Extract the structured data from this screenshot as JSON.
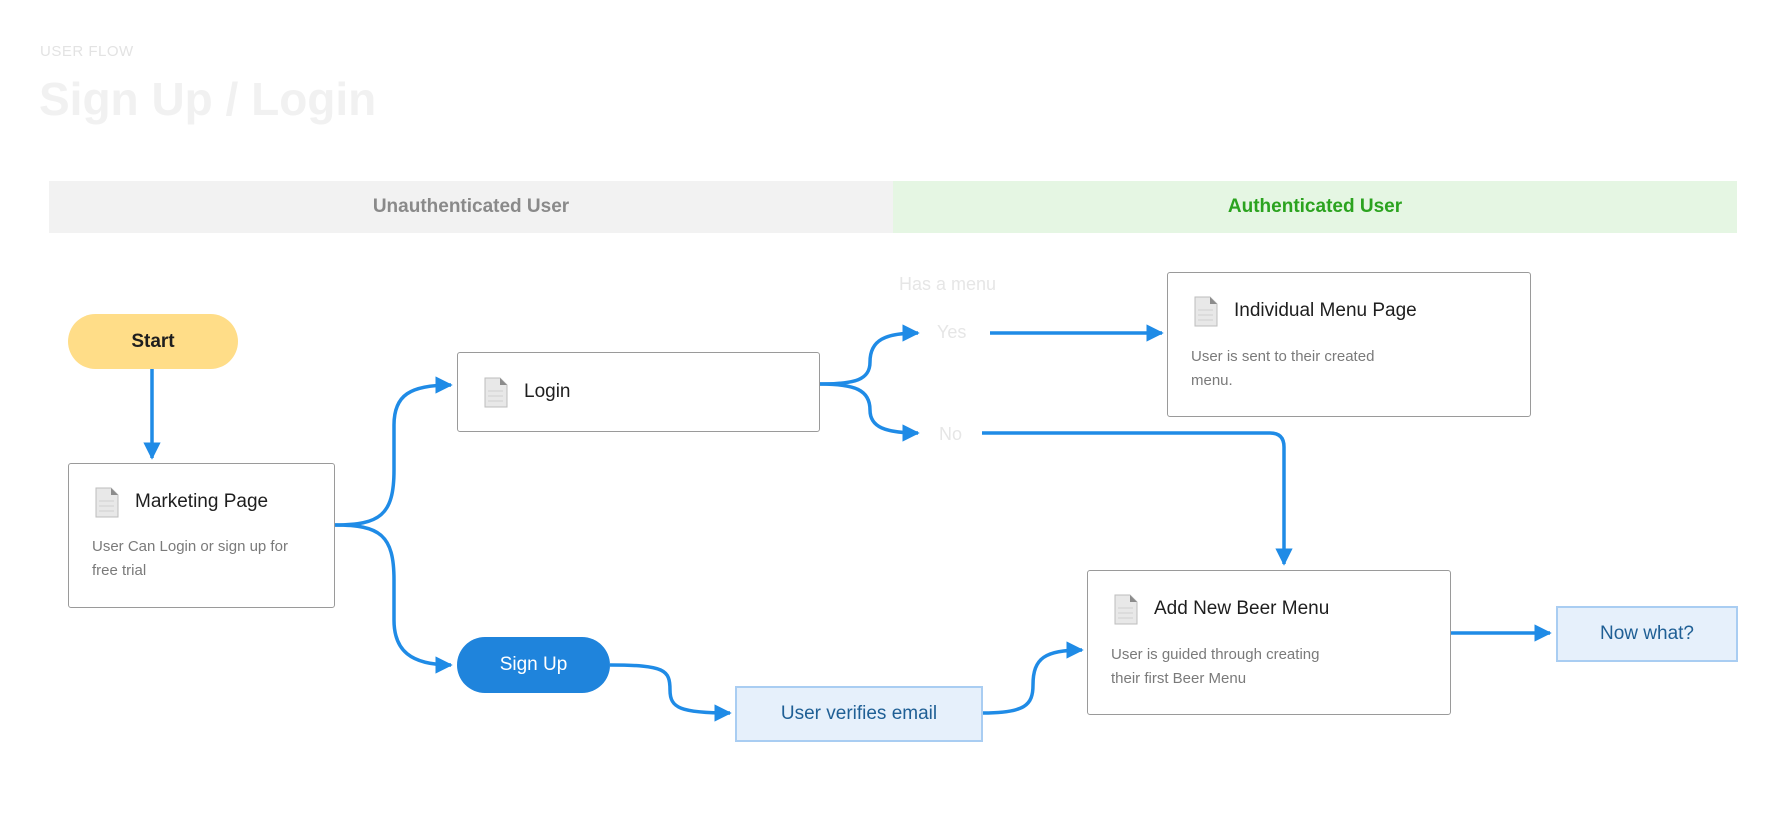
{
  "header": {
    "eyebrow": "USER FLOW",
    "title": "Sign Up / Login"
  },
  "lanes": {
    "unauthenticated": "Unauthenticated User",
    "authenticated": "Authenticated User"
  },
  "nodes": {
    "start": "Start",
    "marketing": {
      "title": "Marketing Page",
      "desc_line1": "User Can Login or sign up for",
      "desc_line2": "free trial"
    },
    "login": {
      "title": "Login"
    },
    "signup": "Sign Up",
    "verify": "User verifies email",
    "menu_page": {
      "title": "Individual Menu Page",
      "desc_line1": "User is sent to their created",
      "desc_line2": "menu."
    },
    "add_menu": {
      "title": "Add New Beer Menu",
      "desc_line1": "User is guided through creating",
      "desc_line2": "their first Beer Menu"
    },
    "now_what": "Now what?"
  },
  "decision": {
    "label": "Has a menu",
    "yes": "Yes",
    "no": "No"
  },
  "colors": {
    "connector": "#1f8be6",
    "start_fill": "#ffdd88",
    "signup_fill": "#1f84dc",
    "auth_lane": "#e5f6e3",
    "auth_text": "#2ba31f",
    "unauth_lane": "#f2f2f2",
    "note_fill": "#e6f0fb"
  },
  "icons": [
    "document-icon"
  ]
}
